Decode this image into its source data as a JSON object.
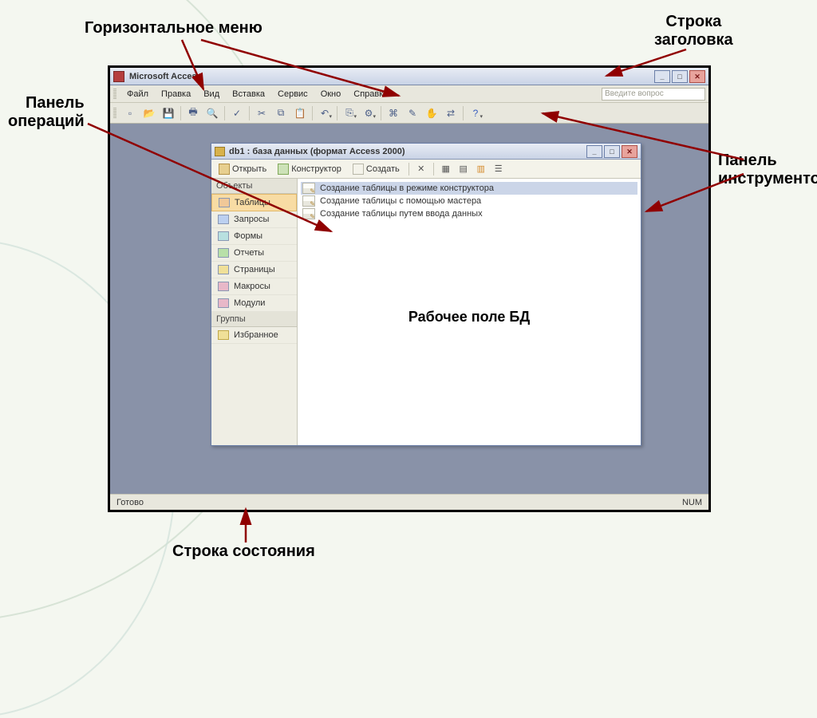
{
  "callouts": {
    "menu": "Горизонтальное меню",
    "title": "Строка\nзаголовка",
    "toolbar": "Панель\nинструментов",
    "ops": "Панель\nопераций",
    "status": "Строка состояния",
    "workfield": "Рабочее поле БД"
  },
  "app": {
    "title": "Microsoft Access",
    "menu": {
      "file": "Файл",
      "edit": "Правка",
      "view": "Вид",
      "insert": "Вставка",
      "service": "Сервис",
      "window": "Окно",
      "help": "Справка"
    },
    "question_placeholder": "Введите вопрос",
    "status_left": "Готово",
    "status_num": "NUM"
  },
  "db": {
    "title": "db1 : база данных (формат Access 2000)",
    "tools": {
      "open": "Открыть",
      "design": "Конструктор",
      "create": "Создать"
    },
    "nav_headers": {
      "objects": "Объекты",
      "groups": "Группы"
    },
    "nav": {
      "tables": "Таблицы",
      "queries": "Запросы",
      "forms": "Формы",
      "reports": "Отчеты",
      "pages": "Страницы",
      "macros": "Макросы",
      "modules": "Модули",
      "favorites": "Избранное"
    },
    "list": {
      "r1": "Создание таблицы в режиме конструктора",
      "r2": "Создание таблицы с помощью мастера",
      "r3": "Создание таблицы путем ввода данных"
    }
  }
}
